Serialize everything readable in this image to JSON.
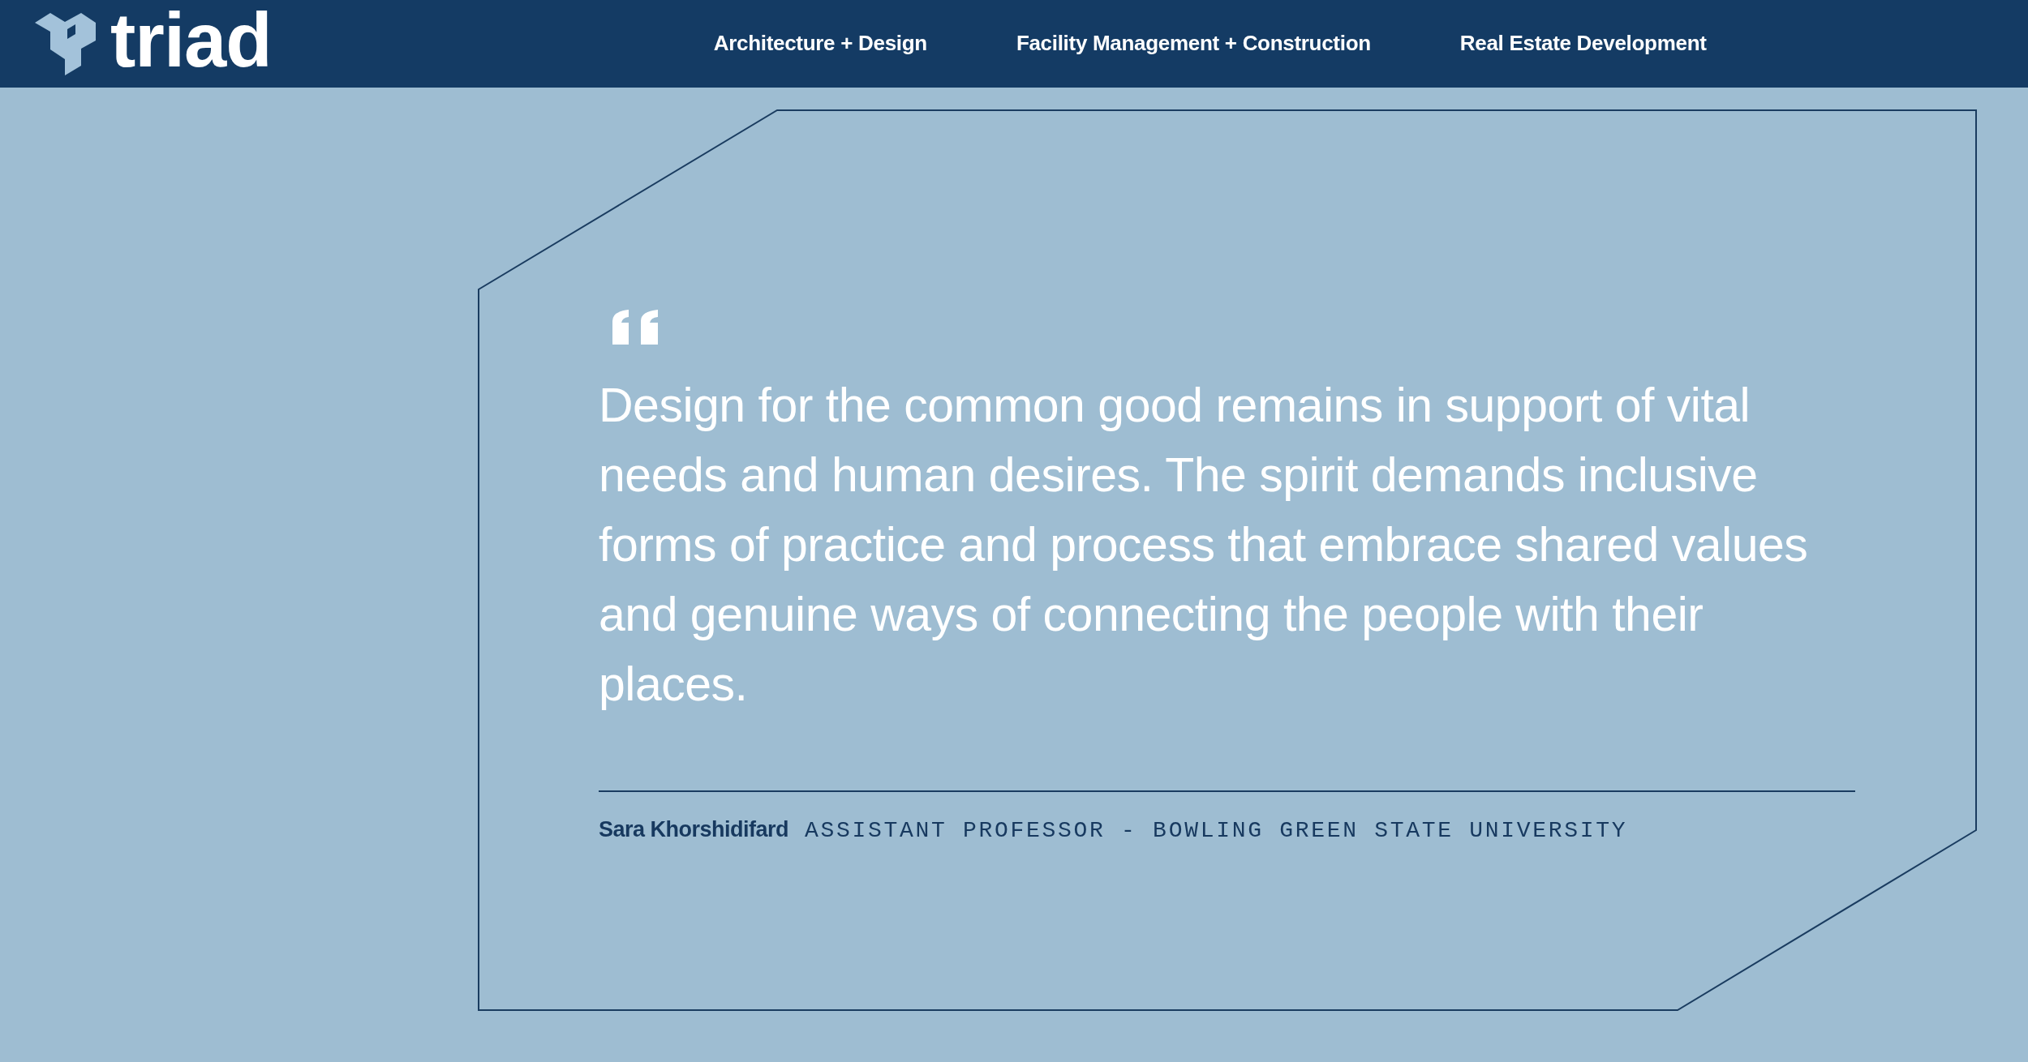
{
  "header": {
    "logo_text": "triad",
    "nav": [
      "Architecture + Design",
      "Facility Management + Construction",
      "Real Estate Development"
    ]
  },
  "testimonial": {
    "quote": "Design for the common good remains in support of vital needs and human desires. The spirit demands inclusive forms of practice and process that embrace shared values and genuine ways of connecting the people with their places.",
    "author": "Sara Khorshidifard",
    "author_title": "ASSISTANT PROFESSOR - BOWLING GREEN STATE UNIVERSITY"
  }
}
